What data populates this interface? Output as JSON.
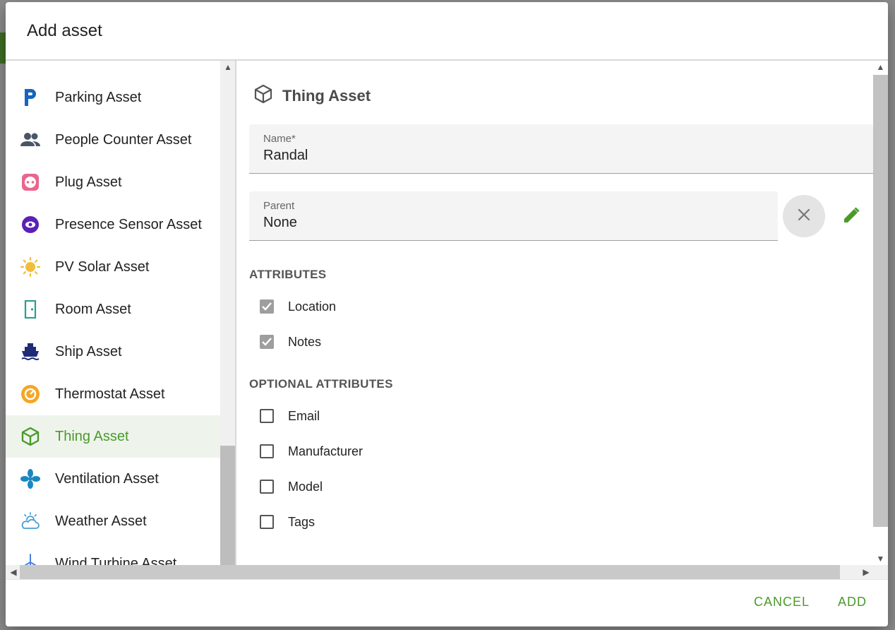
{
  "dialog": {
    "title": "Add asset"
  },
  "asset_list": {
    "items": [
      {
        "label": "Parking Asset",
        "icon": "parking-icon",
        "color": "#1565c0"
      },
      {
        "label": "People Counter Asset",
        "icon": "people-icon",
        "color": "#4a5568"
      },
      {
        "label": "Plug Asset",
        "icon": "power-socket-icon",
        "color": "#e8668f"
      },
      {
        "label": "Presence Sensor Asset",
        "icon": "eye-circle-icon",
        "color": "#5b21b6"
      },
      {
        "label": "PV Solar Asset",
        "icon": "sun-icon",
        "color": "#f0bd3c"
      },
      {
        "label": "Room Asset",
        "icon": "door-icon",
        "color": "#2a9d8f"
      },
      {
        "label": "Ship Asset",
        "icon": "ferry-icon",
        "color": "#1e2b78"
      },
      {
        "label": "Thermostat Asset",
        "icon": "thermostat-icon",
        "color": "#f5a623"
      },
      {
        "label": "Thing Asset",
        "icon": "cube-icon",
        "color": "#4a9a2a",
        "selected": true
      },
      {
        "label": "Ventilation Asset",
        "icon": "fan-icon",
        "color": "#1a87c2"
      },
      {
        "label": "Weather Asset",
        "icon": "weather-partly-cloudy-icon",
        "color": "#4a9fd4"
      },
      {
        "label": "Wind Turbine Asset",
        "icon": "wind-turbine-icon",
        "color": "#4a7fe0"
      }
    ]
  },
  "form": {
    "asset_type": "Thing Asset",
    "name_label": "Name*",
    "name_value": "Randal",
    "parent_label": "Parent",
    "parent_value": "None",
    "attributes_title": "ATTRIBUTES",
    "attributes": [
      {
        "label": "Location",
        "checked": true
      },
      {
        "label": "Notes",
        "checked": true
      }
    ],
    "optional_title": "OPTIONAL ATTRIBUTES",
    "optional_attributes": [
      {
        "label": "Email",
        "checked": false
      },
      {
        "label": "Manufacturer",
        "checked": false
      },
      {
        "label": "Model",
        "checked": false
      },
      {
        "label": "Tags",
        "checked": false
      }
    ]
  },
  "footer": {
    "cancel_label": "CANCEL",
    "add_label": "ADD"
  },
  "colors": {
    "accent": "#4a9a2a",
    "selected_bg": "#eef4ec"
  }
}
